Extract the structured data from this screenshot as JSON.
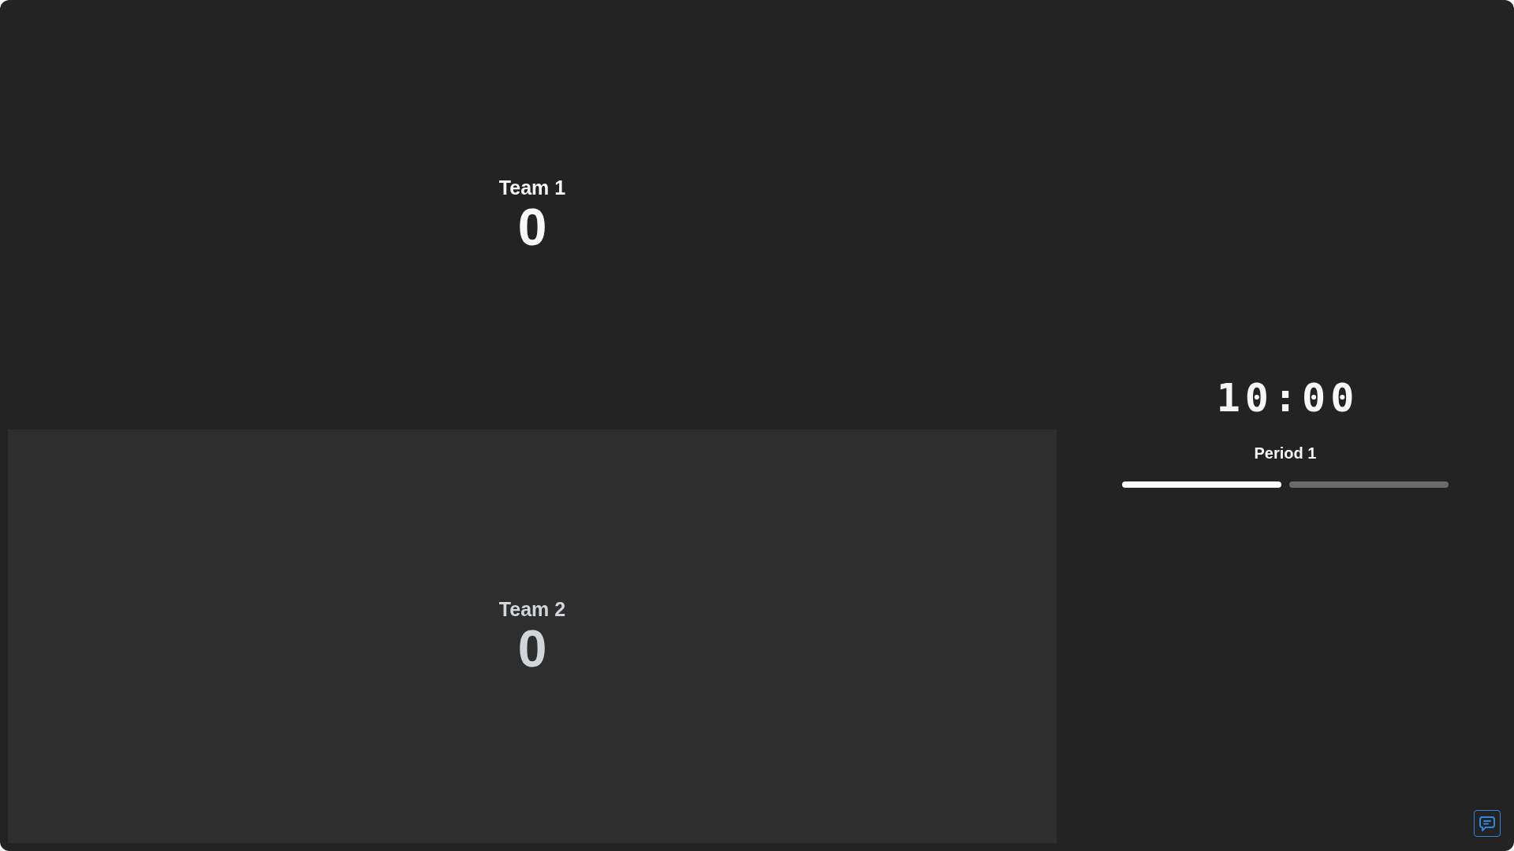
{
  "teams": [
    {
      "name": "Team 1",
      "score": "0",
      "selected": false
    },
    {
      "name": "Team 2",
      "score": "0",
      "selected": true
    }
  ],
  "clock": {
    "time": "10:00",
    "period": "Period 1",
    "segments": [
      {
        "filled": true
      },
      {
        "filled": false
      }
    ]
  }
}
